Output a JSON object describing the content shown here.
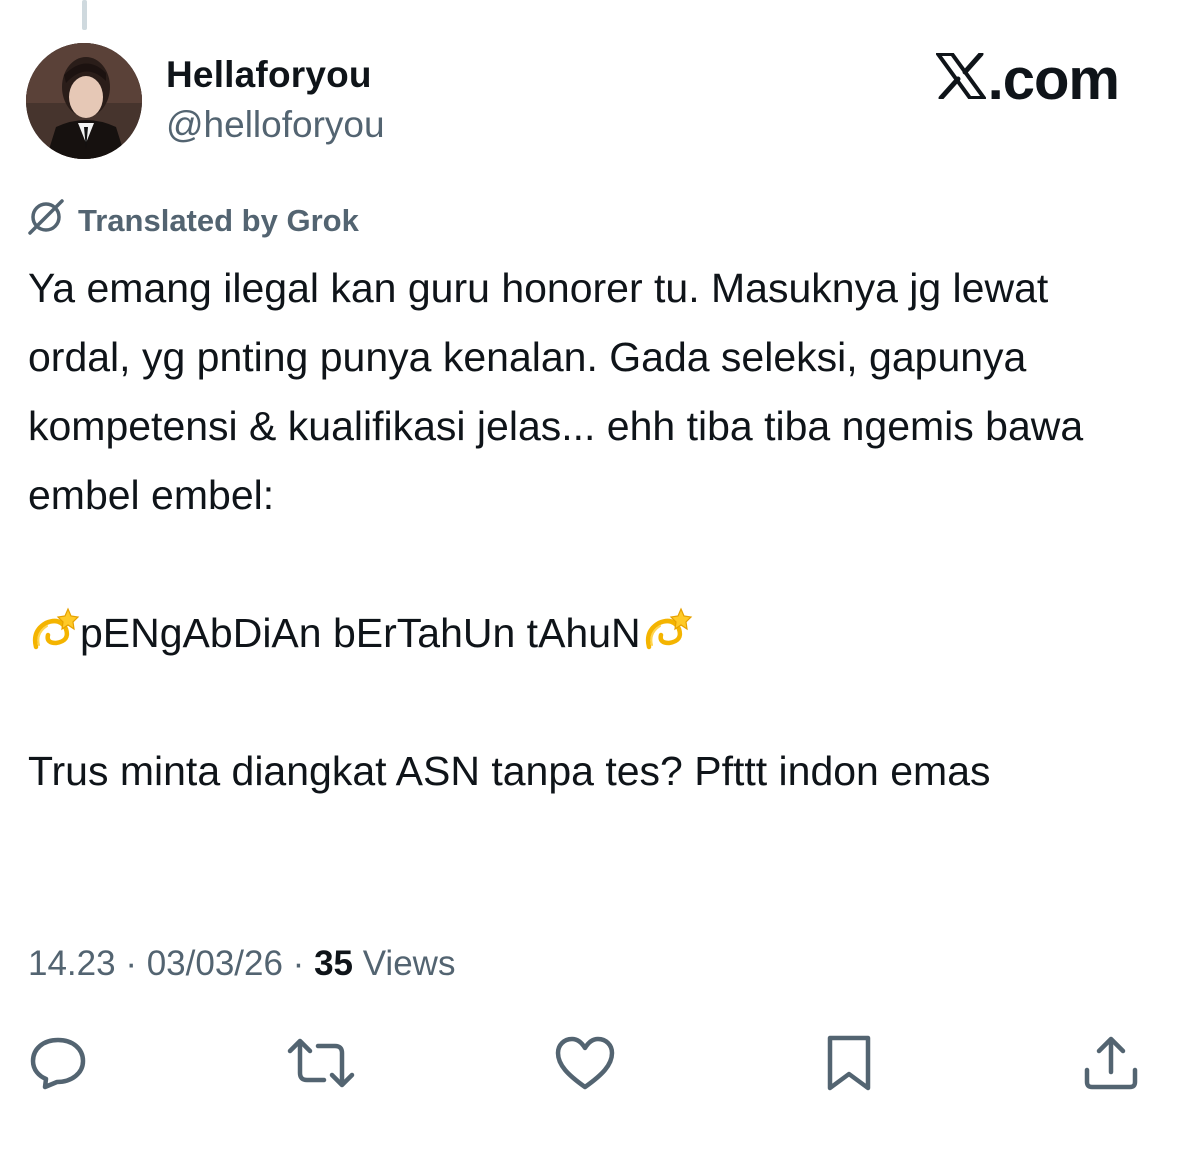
{
  "author": {
    "display_name": "Hellaforyou",
    "handle": "@helloforyou"
  },
  "brand": {
    "logo_icon": "x-logo-icon",
    "suffix": ".com"
  },
  "translation": {
    "icon": "grok-icon",
    "label": "Translated by Grok"
  },
  "tweet": {
    "line_1": "Ya emang ilegal kan guru honorer tu. Masuknya jg lewat ordal, yg pnting punya kenalan. Gada seleksi, gapunya kompetensi & kualifikasi jelas... ehh tiba tiba ngemis bawa embel embel:",
    "emphasis_emoji": "dizzy-emoji",
    "emphasis_text": "pENgAbDiAn bErTahUn tAhuN",
    "line_3": "Trus minta diangkat ASN tanpa tes? Pfttt indon emas"
  },
  "meta": {
    "time": "14.23",
    "separator": " · ",
    "date": "03/03/26",
    "views_count": "35",
    "views_label": " Views"
  },
  "actions": [
    {
      "icon": "reply-icon"
    },
    {
      "icon": "repost-icon"
    },
    {
      "icon": "like-icon"
    },
    {
      "icon": "bookmark-icon"
    },
    {
      "icon": "share-icon"
    }
  ],
  "colors": {
    "text": "#0f1419",
    "secondary": "#536471",
    "thread_line": "#cfd9de"
  }
}
